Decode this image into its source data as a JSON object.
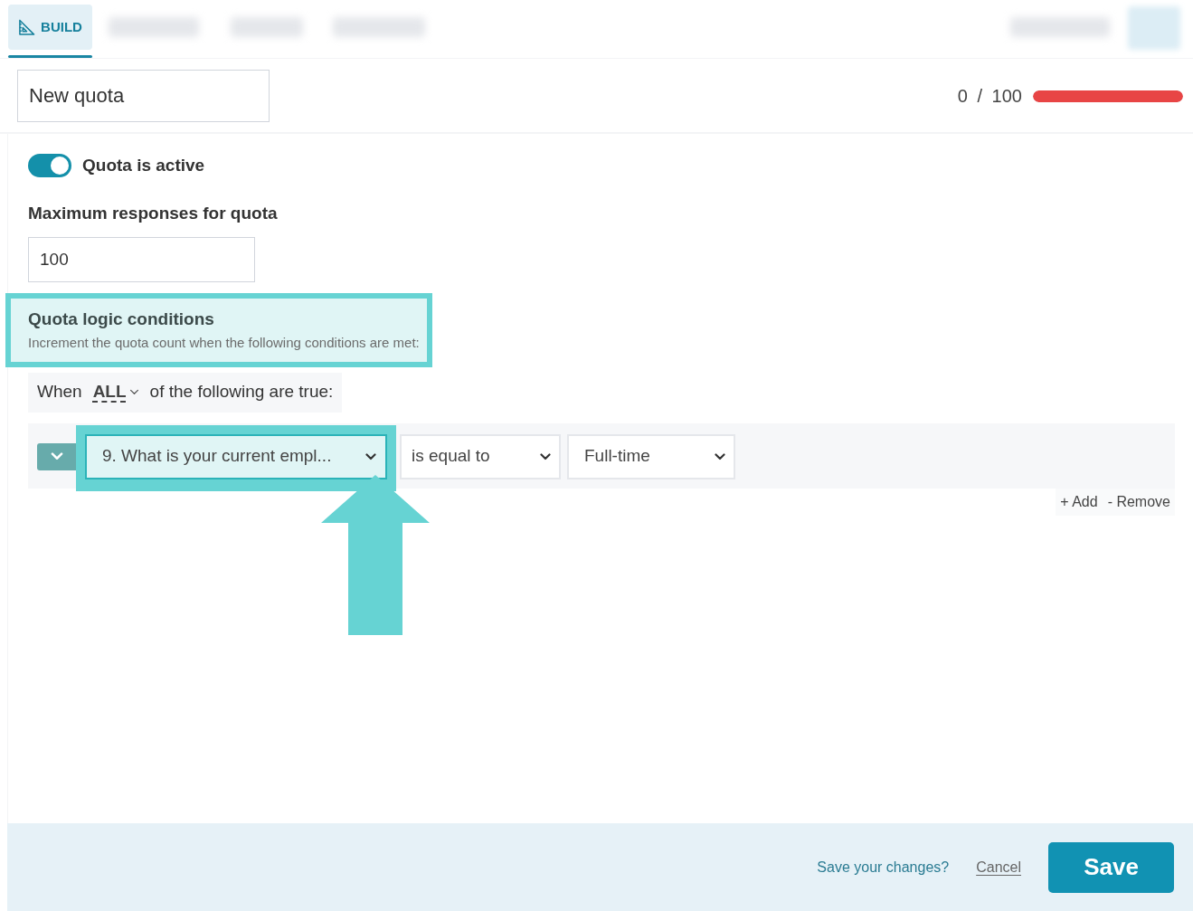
{
  "tabs": [
    {
      "label": "BUILD",
      "selected": true
    }
  ],
  "quota_name": {
    "value": "New quota"
  },
  "progress": {
    "reading": "0 / 100",
    "level": 1
  },
  "active_toggle": {
    "label": "Quota is active",
    "on": true
  },
  "max_responses": {
    "label": "Maximum responses for quota",
    "value": "100"
  },
  "logic_section": {
    "title": "Quota logic conditions",
    "description": "Increment the quota count when the following conditions are met:",
    "highlighted": true
  },
  "match_rule": {
    "prefix": "When",
    "mode": "ALL",
    "suffix": "of the following are true:"
  },
  "conditions": [
    {
      "question": "9. What is your current empl...",
      "operator": "is equal to",
      "value": "Full-time",
      "highlighted": true
    }
  ],
  "condition_actions": [
    "+ Add",
    "- Remove"
  ],
  "footer": {
    "prompt": "Save your changes?",
    "cancel": "Cancel",
    "save": "Save"
  }
}
